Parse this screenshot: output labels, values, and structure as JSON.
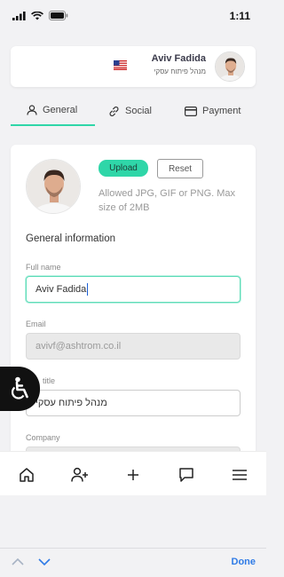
{
  "status_bar": {
    "time": "1:11"
  },
  "profile": {
    "name": "Aviv Fadida",
    "role": "מנהל פיתוח עסקי"
  },
  "tabs": [
    {
      "label": "General",
      "icon": "user-icon",
      "active": true
    },
    {
      "label": "Social",
      "icon": "link-icon",
      "active": false
    },
    {
      "label": "Payment",
      "icon": "credit-card-icon",
      "active": false
    }
  ],
  "form": {
    "upload_label": "Upload",
    "reset_label": "Reset",
    "hint": "Allowed JPG, GIF or PNG. Max size of 2MB",
    "section_title": "General information",
    "fields": {
      "full_name": {
        "label": "Full name",
        "value": "Aviv Fadida"
      },
      "email": {
        "label": "Email",
        "value": "avivf@ashtrom.co.il"
      },
      "job_title": {
        "label": "title",
        "value": "מנהל פיתוח עסקי"
      },
      "company": {
        "label": "Company",
        "value": ""
      }
    }
  },
  "bottom_nav": [
    {
      "icon": "home-icon"
    },
    {
      "icon": "add-user-icon"
    },
    {
      "icon": "plus-icon"
    },
    {
      "icon": "chat-icon"
    },
    {
      "icon": "menu-icon"
    }
  ],
  "keyboard_bar": {
    "done_label": "Done"
  },
  "colors": {
    "accent": "#2fd6a8",
    "link": "#2f7be6"
  }
}
